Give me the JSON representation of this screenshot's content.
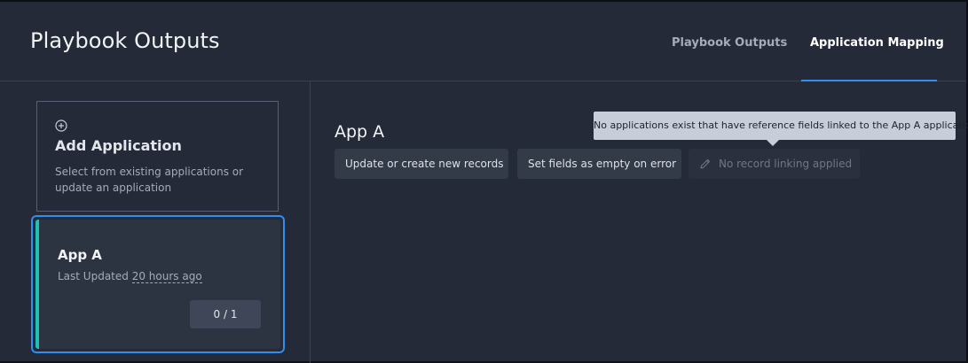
{
  "header": {
    "title": "Playbook Outputs",
    "tabs": [
      {
        "label": "Playbook Outputs",
        "active": false
      },
      {
        "label": "Application Mapping",
        "active": true
      }
    ]
  },
  "sidebar": {
    "add_card": {
      "icon": "plus-circle-icon",
      "title": "Add Application",
      "description": "Select from existing applications or update an application"
    },
    "app_card": {
      "title": "App A",
      "updated_prefix": "Last Updated",
      "updated_time": "20 hours ago",
      "count": "0 / 1",
      "selected": true
    }
  },
  "main": {
    "title": "App A",
    "buttons": [
      {
        "label": "Update or create new records",
        "enabled": true
      },
      {
        "label": "Set fields as empty on error",
        "enabled": true
      },
      {
        "label": "No record linking applied",
        "enabled": false,
        "icon": "pencil-icon"
      }
    ],
    "tooltip": "No applications exist that have reference fields linked to the App A application"
  },
  "colors": {
    "background": "#242a37",
    "accent_blue": "#2f8ef0",
    "accent_teal": "#1ec2b3",
    "tooltip_bg": "#c8ced9"
  }
}
